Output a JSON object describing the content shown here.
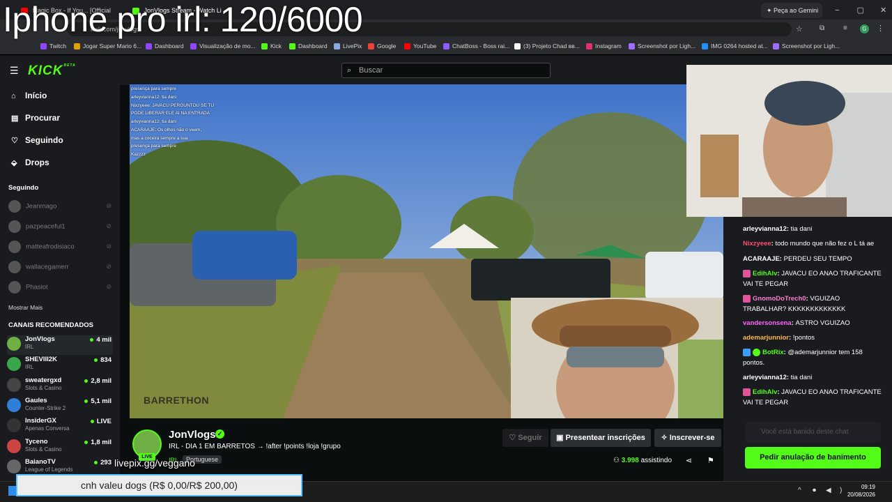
{
  "overlay_title": "Iphone pro irl: 120/6000",
  "browser": {
    "tabs": [
      {
        "label": "Magic Box - If You... [Official",
        "color": "#ff0000"
      },
      {
        "label": "JonVlogs Stream - Watch Li",
        "color": "#53fc18"
      }
    ],
    "gemini_label": "Peça ao Gemini",
    "url": "kick.com/jonvlogs",
    "bookmarks": [
      {
        "label": "Twitch",
        "color": "#9146ff"
      },
      {
        "label": "Jogar Super Mario 6...",
        "color": "#e0a000"
      },
      {
        "label": "Dashboard",
        "color": "#9146ff"
      },
      {
        "label": "Visualização de mo...",
        "color": "#9146ff"
      },
      {
        "label": "Kick",
        "color": "#53fc18"
      },
      {
        "label": "Dashboard",
        "color": "#53fc18"
      },
      {
        "label": "LivePix",
        "color": "#8ad"
      },
      {
        "label": "Google",
        "color": "#ea4335"
      },
      {
        "label": "YouTube",
        "color": "#ff0000"
      },
      {
        "label": "ChatBoss - Boss rai...",
        "color": "#8c5cff"
      },
      {
        "label": "(3) Projeto Chad вв...",
        "color": "#ffffff"
      },
      {
        "label": "Instagram",
        "color": "#e1306c"
      },
      {
        "label": "Screenshot por Ligh...",
        "color": "#a06cff"
      },
      {
        "label": "IMG 0264 hosted at...",
        "color": "#1e90ff"
      },
      {
        "label": "Screenshot por Ligh...",
        "color": "#a06cff"
      }
    ]
  },
  "kick": {
    "logo": "KICK",
    "logo_beta": "BETA",
    "search_placeholder": "Buscar",
    "nav": [
      {
        "label": "Início",
        "icon": "home-icon"
      },
      {
        "label": "Procurar",
        "icon": "browse-icon"
      },
      {
        "label": "Seguindo",
        "icon": "heart-icon"
      },
      {
        "label": "Drops",
        "icon": "drops-icon"
      }
    ],
    "following_header": "Seguindo",
    "following": [
      "Jeanmago",
      "pazpeaceful1",
      "matteafrodisiaco",
      "wallacegamerr",
      "Phasiot"
    ],
    "show_more": "Mostrar Mais",
    "recommended_header": "CANAIS RECOMENDADOS",
    "recommended": [
      {
        "name": "JonVlogs",
        "category": "IRL",
        "viewers": "4 mil",
        "color": "#6fb045"
      },
      {
        "name": "SHEVIII2K",
        "category": "IRL",
        "viewers": "834",
        "color": "#3aa64a"
      },
      {
        "name": "sweatergxd",
        "category": "Slots & Casino",
        "viewers": "2,8 mil",
        "color": "#444"
      },
      {
        "name": "Gaules",
        "category": "Counter-Strike 2",
        "viewers": "5,1 mil",
        "color": "#2f7fd8"
      },
      {
        "name": "InsiderGX",
        "category": "Apenas Conversa",
        "viewers": "LIVE",
        "color": "#333"
      },
      {
        "name": "Tyceno",
        "category": "Slots & Casino",
        "viewers": "1,8 mil",
        "color": "#c44"
      },
      {
        "name": "BaianoTV",
        "category": "League of Legends",
        "viewers": "293",
        "color": "#666"
      }
    ]
  },
  "stream_overlay_chat": [
    "presença para sempre",
    "arleyvianna12: tia dani",
    "Nixzyeee: JAVACU PERGUNTOU SE TU",
    "PODE LIBERAR ELE AI NA ENTRADA",
    "arleyvianna12: tia dani",
    "ACARAAJE: Os olhos não o veem,",
    "mas a coceira sempre a sua",
    "presença para sempre",
    "Kazzzz"
  ],
  "chat": [
    {
      "user": "arleyvianna12",
      "text": "tia dani",
      "color": "#ffffff",
      "badge": ""
    },
    {
      "user": "Nixzyeee",
      "text": "todo mundo que não fez o L tá ae",
      "color": "#ff4d6d",
      "badge": ""
    },
    {
      "user": "ACARAAJE",
      "text": "PERDEU SEU TEMPO",
      "color": "#ffffff",
      "badge": ""
    },
    {
      "user": "EdihAlv",
      "text": "JAVACU EO ANAO TRAFICANTE VAI TE PEGAR",
      "color": "#53fc18",
      "badge": "#e0559a"
    },
    {
      "user": "GnomoDoTrech0",
      "text": "VGUIZAO TRABALHAR? KKKKKKKKKKKKK",
      "color": "#ff7dd0",
      "badge": "#e0559a"
    },
    {
      "user": "vandersonsena",
      "text": "ASTRO VGUIZAO",
      "color": "#ff66ff",
      "badge": ""
    },
    {
      "user": "ademarjunnior",
      "text": "!pontos",
      "color": "#ffb84d",
      "badge": ""
    },
    {
      "user": "BotRix",
      "text": "@ademarjunnior tem 158 pontos.",
      "color": "#53fc18",
      "badge": "#3aa0ff"
    },
    {
      "user": "arleyvianna12",
      "text": "tia dani",
      "color": "#ffffff",
      "badge": ""
    },
    {
      "user": "EdihAlv",
      "text": "JAVACU EO ANAO TRAFICANTE VAI TE PEGAR",
      "color": "#53fc18",
      "badge": "#e0559a"
    }
  ],
  "chat_input_placeholder": "Você está banido deste chat",
  "ban_button": "Pedir anulação de banimento",
  "channel": {
    "name": "JonVlogs",
    "live": "LIVE",
    "title": "IRL - DIA 1 EM BARRETOS → !after !points !loja !grupo",
    "category": "IRL",
    "language": "Portuguese",
    "follow_button": "Seguir",
    "gift_button": "Presentear inscrições",
    "subscribe_button": "Inscrever-se",
    "viewer_count": "3.998",
    "viewer_label": "assistindo"
  },
  "overlay_pix": "livepix.gg/veggano",
  "donation_text": "cnh valeu dogs (R$ 0,00/R$ 200,00)",
  "video_logo": "BARRETHON",
  "clock": {
    "time": "09:19",
    "date": "20/08/2026"
  }
}
